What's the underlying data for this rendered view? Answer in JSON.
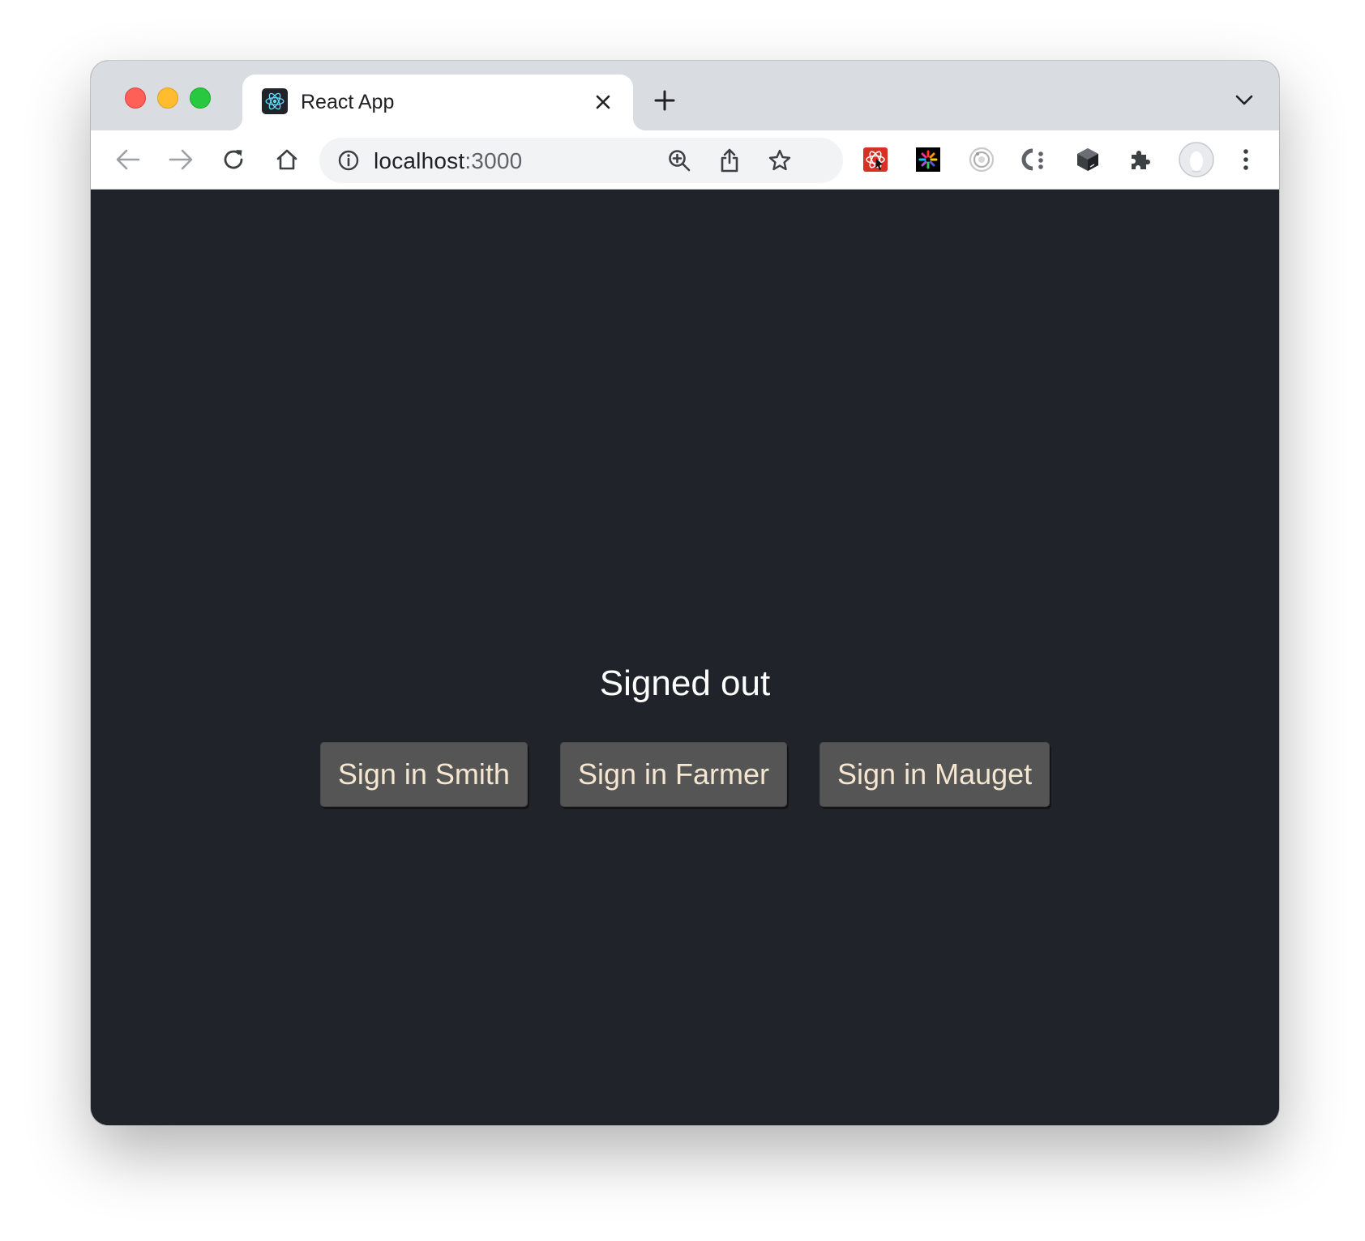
{
  "browser": {
    "tab": {
      "title": "React App",
      "favicon": "react-logo-icon"
    },
    "address": {
      "host": "localhost",
      "port": ":3000"
    },
    "icons": {
      "back": "arrow-left-icon",
      "forward": "arrow-right-icon",
      "reload": "reload-icon",
      "home": "home-icon",
      "zoom": "zoom-in-icon",
      "share": "share-icon",
      "bookmark": "star-icon",
      "extensions": "puzzle-icon",
      "menu": "kebab-menu-icon"
    }
  },
  "app": {
    "status": "Signed out",
    "buttons": [
      "Sign in Smith",
      "Sign in Farmer",
      "Sign in Mauget"
    ]
  },
  "colors": {
    "page_background": "#20232a",
    "button_background": "#555555",
    "button_text": "#f5e6d0",
    "status_text": "#ffffff"
  }
}
